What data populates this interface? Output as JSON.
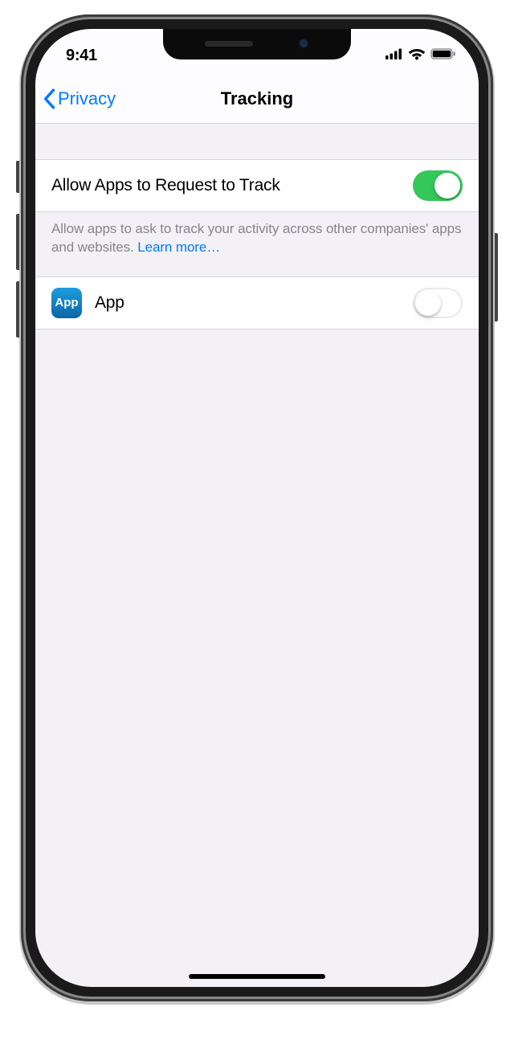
{
  "status": {
    "time": "9:41"
  },
  "nav": {
    "back": "Privacy",
    "title": "Tracking"
  },
  "main": {
    "allow_label": "Allow Apps to Request to Track",
    "allow_on": true,
    "footer": "Allow apps to ask to track your activity across other companies' apps and websites. ",
    "learn_more": "Learn more…"
  },
  "apps": [
    {
      "name": "App",
      "icon_text": "App",
      "on": false
    }
  ]
}
